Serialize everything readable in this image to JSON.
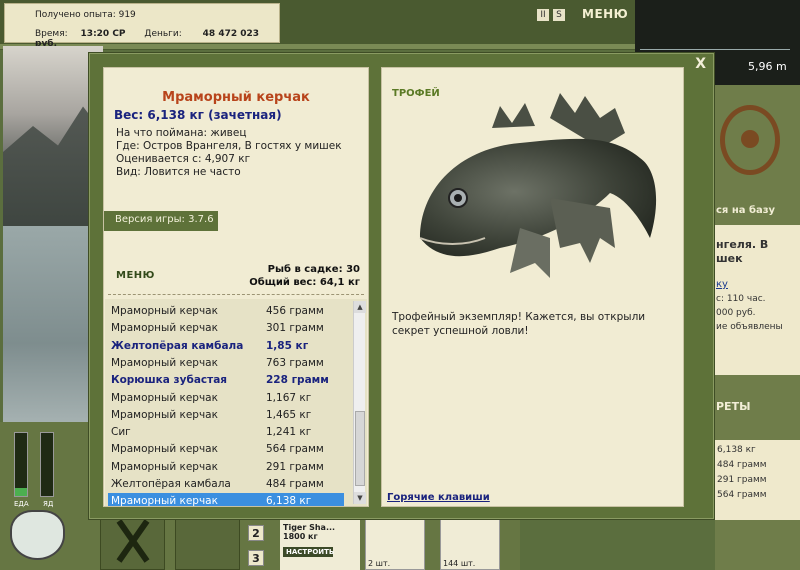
{
  "hud": {
    "exp_label": "Получено опыта: 919",
    "time_label": "Время:",
    "time_value": "13:20 СР",
    "money_label": "Деньги:",
    "money_value": "48 472 023 руб.",
    "menu_label": "МЕНЮ",
    "depth_value": "5,96 m"
  },
  "right_bg": {
    "base_text": "ся на базу",
    "place_text": "нгеля. В\nшек",
    "line1": "ку",
    "line2": "с: 110 час.",
    "line3": "000 руб.",
    "line4": "ие объявлены",
    "section": "РЕТЫ",
    "items": [
      "6,138 кг",
      "484 грамм",
      "291 грамм",
      "564 грамм"
    ]
  },
  "bottom": {
    "gauge_labels": [
      "ЕДА",
      "ЯД"
    ],
    "gauge_levels": [
      0.12,
      0.0
    ],
    "buttons": [
      "2",
      "3"
    ],
    "tackle_name": "Tiger Sha...",
    "tackle_len": "1800 кг",
    "tackle_btn": "НАСТРОИТЬ",
    "item1_count": "2 шт.",
    "item2_count": "144 шт."
  },
  "dialog": {
    "close_label": "X",
    "fish_name": "Мраморный керчак",
    "weight": "Вес: 6,138 кг (зачетная)",
    "info": [
      "На что поймана: живец",
      "Где: Остров Врангеля, В гостях у мишек",
      "Оценивается с: 4,907 кг",
      "Вид: Ловится не часто"
    ],
    "version_label": "Версия игры:",
    "version_value": "3.7.6",
    "menu_label": "МЕНЮ",
    "keepnet_count": "Рыб в садке: 30",
    "keepnet_weight": "Общий вес: 64,1 кг",
    "trophy_label": "ТРОФЕЙ",
    "trophy_text": "Трофейный экземпляр! Кажется, вы открыли секрет успешной ловли!",
    "hotkeys_label": "Горячие клавиши"
  },
  "catch_list": [
    {
      "name": "Мраморный керчак",
      "weight": "456 грамм",
      "trophy": false
    },
    {
      "name": "Мраморный керчак",
      "weight": "301 грамм",
      "trophy": false
    },
    {
      "name": "Желтопёрая камбала",
      "weight": "1,85 кг",
      "trophy": true
    },
    {
      "name": "Мраморный керчак",
      "weight": "763 грамм",
      "trophy": false
    },
    {
      "name": "Корюшка зубастая",
      "weight": "228 грамм",
      "trophy": true
    },
    {
      "name": "Мраморный керчак",
      "weight": "1,167 кг",
      "trophy": false
    },
    {
      "name": "Мраморный керчак",
      "weight": "1,465 кг",
      "trophy": false
    },
    {
      "name": "Сиг",
      "weight": "1,241 кг",
      "trophy": false
    },
    {
      "name": "Мраморный керчак",
      "weight": "564 грамм",
      "trophy": false
    },
    {
      "name": "Мраморный керчак",
      "weight": "291 грамм",
      "trophy": false
    },
    {
      "name": "Желтопёрая камбала",
      "weight": "484 грамм",
      "trophy": false
    },
    {
      "name": "Мраморный керчак",
      "weight": "6,138 кг",
      "trophy": false,
      "selected": true
    }
  ]
}
